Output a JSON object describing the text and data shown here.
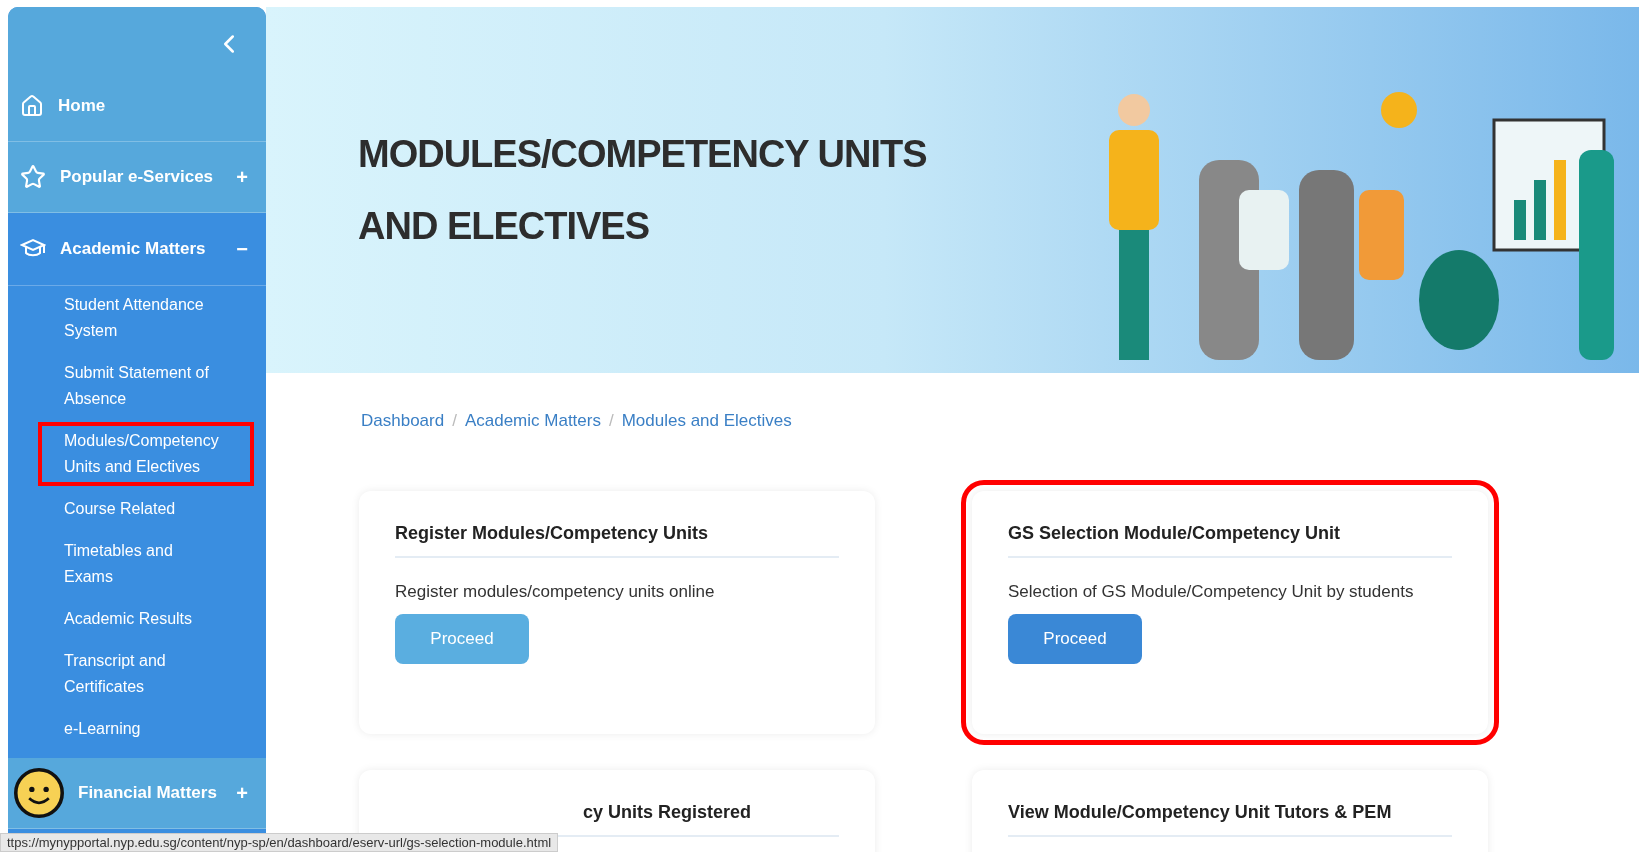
{
  "sidebar": {
    "items": [
      {
        "label": "Home",
        "expanded": false
      },
      {
        "label": "Popular e-Services",
        "expanded": false,
        "toggle": "+"
      },
      {
        "label": "Academic Matters",
        "expanded": true,
        "toggle": "−",
        "children": [
          {
            "label": "Student Attendance System",
            "annotated": false
          },
          {
            "label": "Submit Statement of Absence",
            "annotated": false
          },
          {
            "label": "Modules/Competency Units and Electives",
            "annotated": true
          },
          {
            "label": "Course Related",
            "annotated": false
          },
          {
            "label": "Timetables and Exams",
            "annotated": false
          },
          {
            "label": "Academic Results",
            "annotated": false
          },
          {
            "label": "Transcript and Certificates",
            "annotated": false
          },
          {
            "label": "e-Learning",
            "annotated": false
          }
        ]
      },
      {
        "label": "Financial Matters",
        "expanded": false,
        "toggle": "+"
      }
    ]
  },
  "hero": {
    "title": "MODULES/COMPETENCY UNITS AND ELECTIVES"
  },
  "breadcrumb": [
    {
      "label": "Dashboard"
    },
    {
      "separator": "/",
      "label": "Academic Matters"
    },
    {
      "separator": "/",
      "label": "Modules and Electives"
    }
  ],
  "cards": [
    {
      "title": "Register Modules/Competency Units",
      "description": "Register modules/competency units online",
      "button": "Proceed",
      "primary": false,
      "annotated": false
    },
    {
      "title": "GS Selection Module/Competency Unit",
      "description": "Selection of GS Module/Competency Unit by students",
      "button": "Proceed",
      "primary": true,
      "annotated": true
    },
    {
      "title": "cy Units Registered"
    },
    {
      "title": "View Module/Competency Unit Tutors & PEM"
    }
  ],
  "status_bar": {
    "url": "ttps://mynypportal.nyp.edu.sg/content/nyp-sp/en/dashboard/eserv-url/gs-selection-module.html"
  }
}
